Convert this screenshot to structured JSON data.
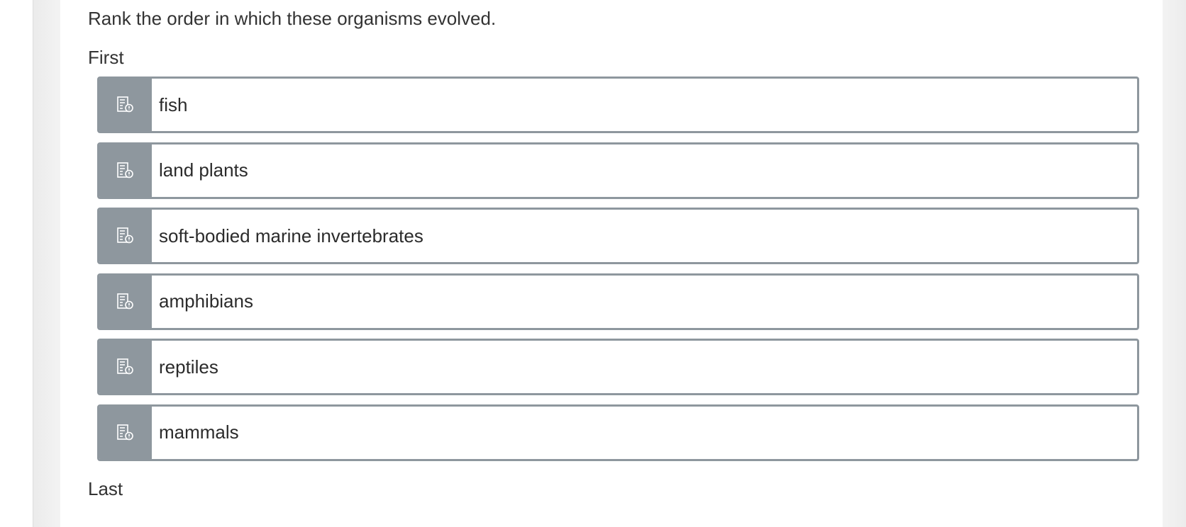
{
  "question": {
    "prompt": "Rank the order in which these organisms evolved.",
    "first_label": "First",
    "last_label": "Last"
  },
  "items": [
    {
      "label": "fish"
    },
    {
      "label": "land plants"
    },
    {
      "label": "soft-bodied marine invertebrates"
    },
    {
      "label": "amphibians"
    },
    {
      "label": "reptiles"
    },
    {
      "label": "mammals"
    }
  ],
  "icons": {
    "drag_handle": "drag-handle-icon"
  },
  "colors": {
    "item_border": "#8e979e",
    "handle_bg": "#8e979e",
    "text": "#333333"
  }
}
